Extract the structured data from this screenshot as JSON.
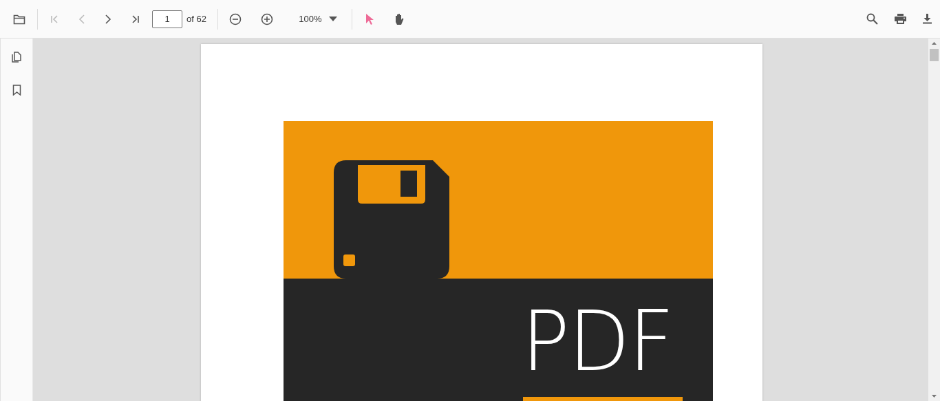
{
  "toolbar": {
    "left": [
      {
        "kind": "open",
        "disabled": false
      },
      {
        "kind": "divider"
      },
      {
        "kind": "first",
        "disabled": true
      },
      {
        "kind": "prev",
        "disabled": true
      },
      {
        "kind": "next",
        "disabled": false
      },
      {
        "kind": "last",
        "disabled": false
      }
    ],
    "page_input": {
      "value": "1"
    },
    "page_count": "of 62",
    "zoom": [
      {
        "kind": "zoom-out",
        "disabled": false
      },
      {
        "kind": "zoom-in",
        "disabled": false
      }
    ],
    "zoom_level": "100%",
    "tools": [
      {
        "kind": "select",
        "selected": true
      },
      {
        "kind": "pan",
        "selected": false
      }
    ],
    "right": [
      {
        "kind": "search"
      },
      {
        "kind": "print"
      },
      {
        "kind": "download"
      }
    ]
  },
  "sidebar": {
    "items": [
      {
        "kind": "thumbnails",
        "selected": false
      },
      {
        "kind": "bookmarks",
        "selected": false
      }
    ]
  },
  "page": {
    "title": "PDF"
  }
}
